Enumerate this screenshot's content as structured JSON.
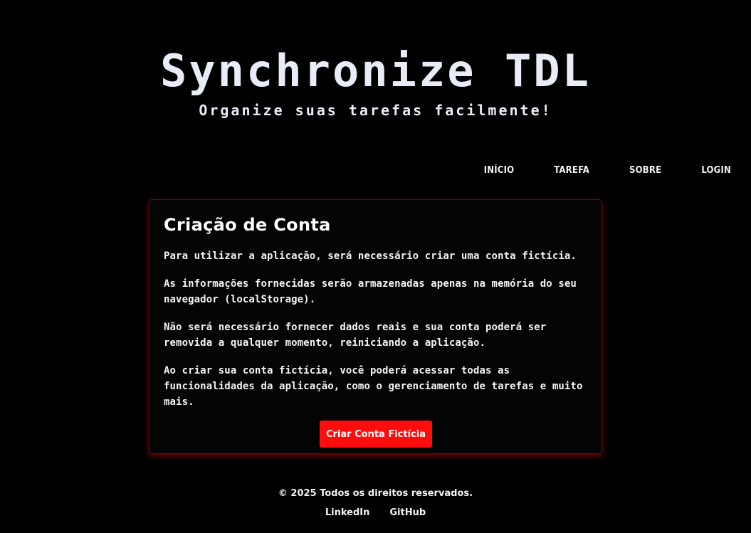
{
  "header": {
    "title": "Synchronize TDL",
    "subtitle": "Organize suas tarefas facilmente!"
  },
  "nav": {
    "items": [
      {
        "label": "INÍCIO"
      },
      {
        "label": "TAREFA"
      },
      {
        "label": "SOBRE"
      },
      {
        "label": "LOGIN"
      }
    ]
  },
  "card": {
    "title": "Criação de Conta",
    "paragraphs": [
      "Para utilizar a aplicação, será necessário criar uma conta fictícia.",
      "As informações fornecidas serão armazenadas apenas na memória do seu navegador (localStorage).",
      "Não será necessário fornecer dados reais e sua conta poderá ser removida a qualquer momento, reiniciando a aplicação.",
      "Ao criar sua conta fictícia, você poderá acessar todas as funcionalidades da aplicação, como o gerenciamento de tarefas e muito mais."
    ],
    "button_label": "Criar Conta Fictícia"
  },
  "footer": {
    "copyright": "© 2025 Todos os direitos reservados.",
    "links": [
      {
        "label": "LinkedIn"
      },
      {
        "label": "GitHub"
      }
    ]
  },
  "colors": {
    "background": "#000000",
    "title": "#e8ecf7",
    "accent": "#ff0d0d",
    "card_glow": "#ff0000"
  }
}
